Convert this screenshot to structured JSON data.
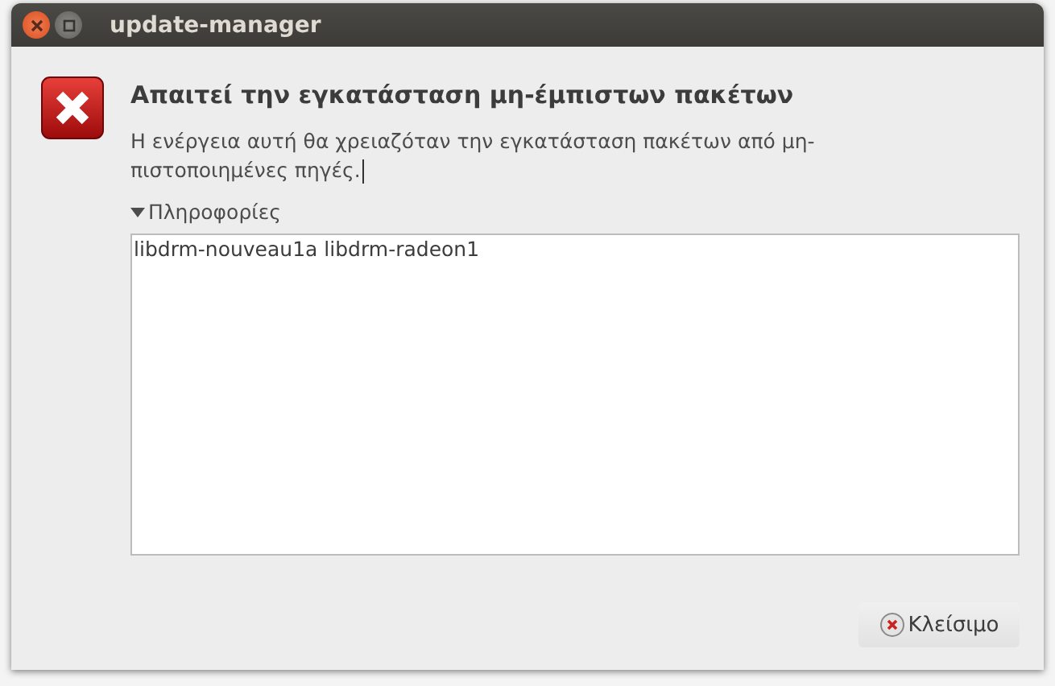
{
  "window": {
    "title": "update-manager"
  },
  "dialog": {
    "heading": "Απαιτεί την εγκατάσταση μη-έμπιστων πακέτων",
    "message": "Η ενέργεια αυτή θα χρειαζόταν την εγκατάσταση πακέτων από μη-πιστοποιημένες πηγές.",
    "details": {
      "label": "Πληροφορίες",
      "expanded": true,
      "text": "libdrm-nouveau1a libdrm-radeon1"
    }
  },
  "buttons": [
    {
      "label": "Κλείσιμο",
      "kind": "close"
    }
  ]
}
